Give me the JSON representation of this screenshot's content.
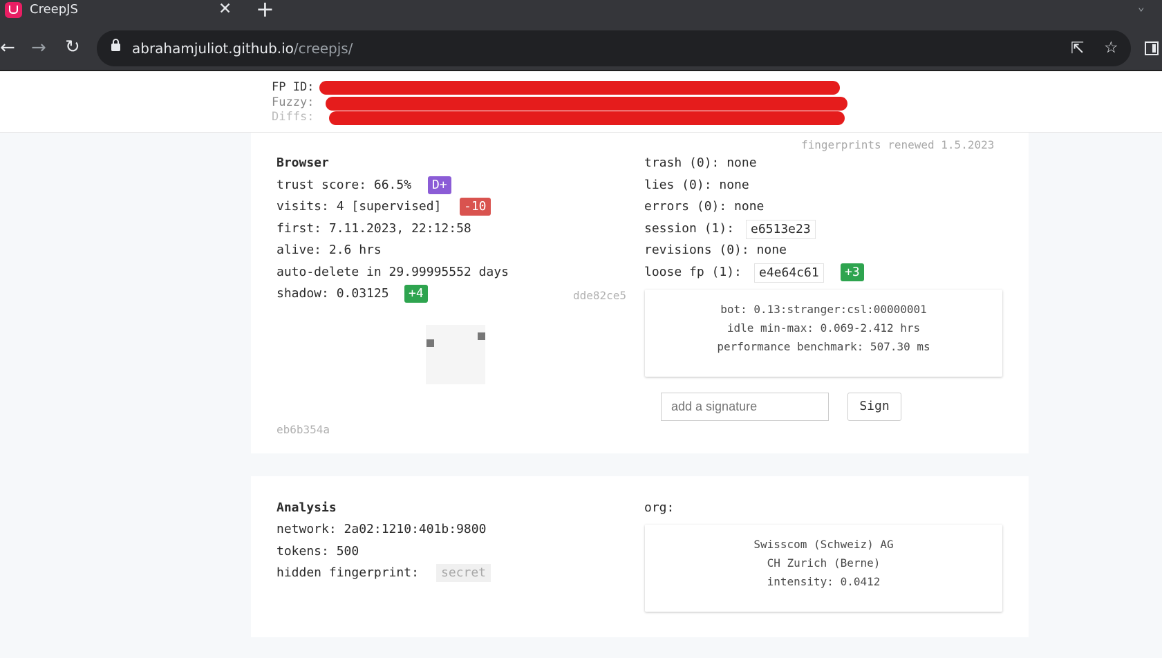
{
  "browser": {
    "tab_title": "CreepJS",
    "tab_close": "✕",
    "new_tab": "+",
    "url_host": "abrahamjuliot.github.io",
    "url_path": "/creepjs/"
  },
  "header": {
    "fp_id_label": "FP ID:",
    "fuzzy_label": "Fuzzy:",
    "diffs_label": "Diffs:"
  },
  "browser_card": {
    "renewed": "fingerprints renewed 1.5.2023",
    "title": "Browser",
    "trust_score": "trust score: 66.5%",
    "trust_grade": "D+",
    "visits": "visits: 4 [supervised]",
    "visits_badge": "-10",
    "first": "first: 7.11.2023, 22:12:58",
    "alive": "alive: 2.6 hrs",
    "auto_delete": "auto-delete in 29.99995552 days",
    "shadow": "shadow: 0.03125",
    "shadow_badge": "+4",
    "hash_right": "dde82ce5",
    "hash_bottom": "eb6b354a",
    "trash": "trash (0): none",
    "lies": "lies (0): none",
    "errors": "errors (0): none",
    "session_label": "session (1):",
    "session_value": "e6513e23",
    "revisions": "revisions (0): none",
    "loose_fp_label": "loose fp (1):",
    "loose_fp_value": "e4e64c61",
    "loose_fp_badge": "+3",
    "bot": "bot: 0.13:stranger:csl:00000001",
    "idle": "idle min-max: 0.069-2.412 hrs",
    "performance": "performance benchmark: 507.30 ms",
    "signature_placeholder": "add a signature",
    "sign_button": "Sign"
  },
  "analysis_card": {
    "title": "Analysis",
    "network": "network: 2a02:1210:401b:9800",
    "tokens": "tokens: 500",
    "hidden_label": "hidden fingerprint:",
    "hidden_value": "secret",
    "org_label": "org:",
    "org_name": "Swisscom (Schweiz) AG",
    "org_location": "CH Zurich (Berne)",
    "org_intensity": "intensity: 0.0412"
  },
  "colors": {
    "redaction": "#e51c1c",
    "grade_purple": "#8b5cd6",
    "negative_red": "#d9534f",
    "positive_green": "#2ea44f"
  }
}
